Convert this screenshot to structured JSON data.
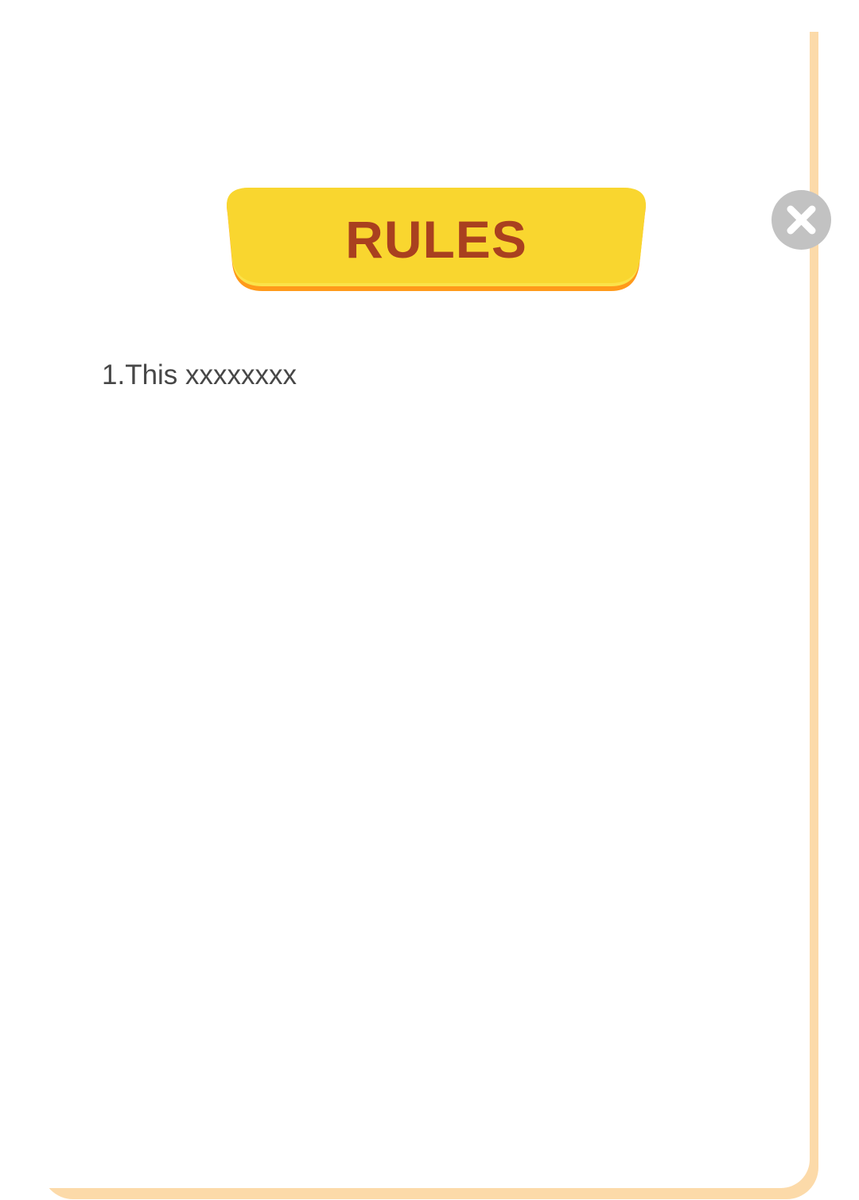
{
  "dialog": {
    "title": "RULES",
    "close_icon": "close-icon",
    "rules": [
      "1.This xxxxxxxx"
    ]
  },
  "colors": {
    "banner": "#f9d62f",
    "banner_edge": "#ff9a1a",
    "title_text": "#a9401f",
    "card_shadow": "#fcdaa9",
    "close_bg": "#c2c2c2",
    "body_text": "#474747"
  }
}
